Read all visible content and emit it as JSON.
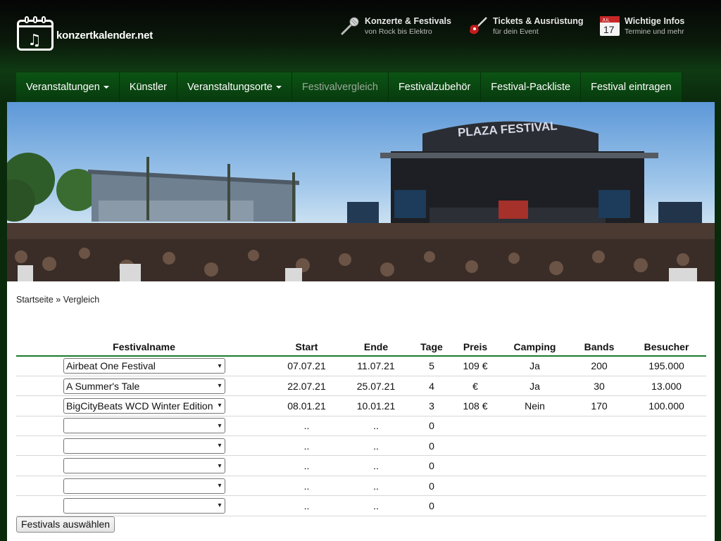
{
  "site": {
    "logo_text": "konzertkalender.net"
  },
  "header_links": [
    {
      "title": "Konzerte & Festivals",
      "subtitle": "von Rock bis Elektro",
      "icon": "microphone-icon"
    },
    {
      "title": "Tickets & Ausrüstung",
      "subtitle": "für dein Event",
      "icon": "guitar-icon"
    },
    {
      "title": "Wichtige Infos",
      "subtitle": "Termine und mehr",
      "icon": "calendar-icon",
      "calendar_day": "17",
      "calendar_month": "JUL"
    }
  ],
  "nav": [
    {
      "label": "Veranstaltungen",
      "dropdown": true
    },
    {
      "label": "Künstler",
      "dropdown": false
    },
    {
      "label": "Veranstaltungsorte",
      "dropdown": true
    },
    {
      "label": "Festivalvergleich",
      "dropdown": false,
      "active": true
    },
    {
      "label": "Festivalzubehör",
      "dropdown": false
    },
    {
      "label": "Festival-Packliste",
      "dropdown": false
    },
    {
      "label": "Festival eintragen",
      "dropdown": false
    }
  ],
  "hero": {
    "stage_sign": "PLAZA FESTIVAL"
  },
  "breadcrumb": {
    "home": "Startseite",
    "separator": "»",
    "current": "Vergleich"
  },
  "table": {
    "headers": [
      "Festivalname",
      "Start",
      "Ende",
      "Tage",
      "Preis",
      "Camping",
      "Bands",
      "Besucher"
    ],
    "rows": [
      {
        "name": "Airbeat One Festival",
        "start": "07.07.21",
        "end": "11.07.21",
        "days": "5",
        "price": "109 €",
        "camping": "Ja",
        "bands": "200",
        "visitors": "195.000"
      },
      {
        "name": "A Summer's Tale",
        "start": "22.07.21",
        "end": "25.07.21",
        "days": "4",
        "price": "€",
        "camping": "Ja",
        "bands": "30",
        "visitors": "13.000"
      },
      {
        "name": "BigCityBeats WCD Winter Edition",
        "start": "08.01.21",
        "end": "10.01.21",
        "days": "3",
        "price": "108 €",
        "camping": "Nein",
        "bands": "170",
        "visitors": "100.000"
      },
      {
        "name": "",
        "start": "..",
        "end": "..",
        "days": "0",
        "price": "",
        "camping": "",
        "bands": "",
        "visitors": ""
      },
      {
        "name": "",
        "start": "..",
        "end": "..",
        "days": "0",
        "price": "",
        "camping": "",
        "bands": "",
        "visitors": ""
      },
      {
        "name": "",
        "start": "..",
        "end": "..",
        "days": "0",
        "price": "",
        "camping": "",
        "bands": "",
        "visitors": ""
      },
      {
        "name": "",
        "start": "..",
        "end": "..",
        "days": "0",
        "price": "",
        "camping": "",
        "bands": "",
        "visitors": ""
      },
      {
        "name": "",
        "start": "..",
        "end": "..",
        "days": "0",
        "price": "",
        "camping": "",
        "bands": "",
        "visitors": ""
      }
    ]
  },
  "submit_label": "Festivals auswählen",
  "colors": {
    "nav_green": "#0b5413",
    "accent_green": "#1a7a2c"
  }
}
